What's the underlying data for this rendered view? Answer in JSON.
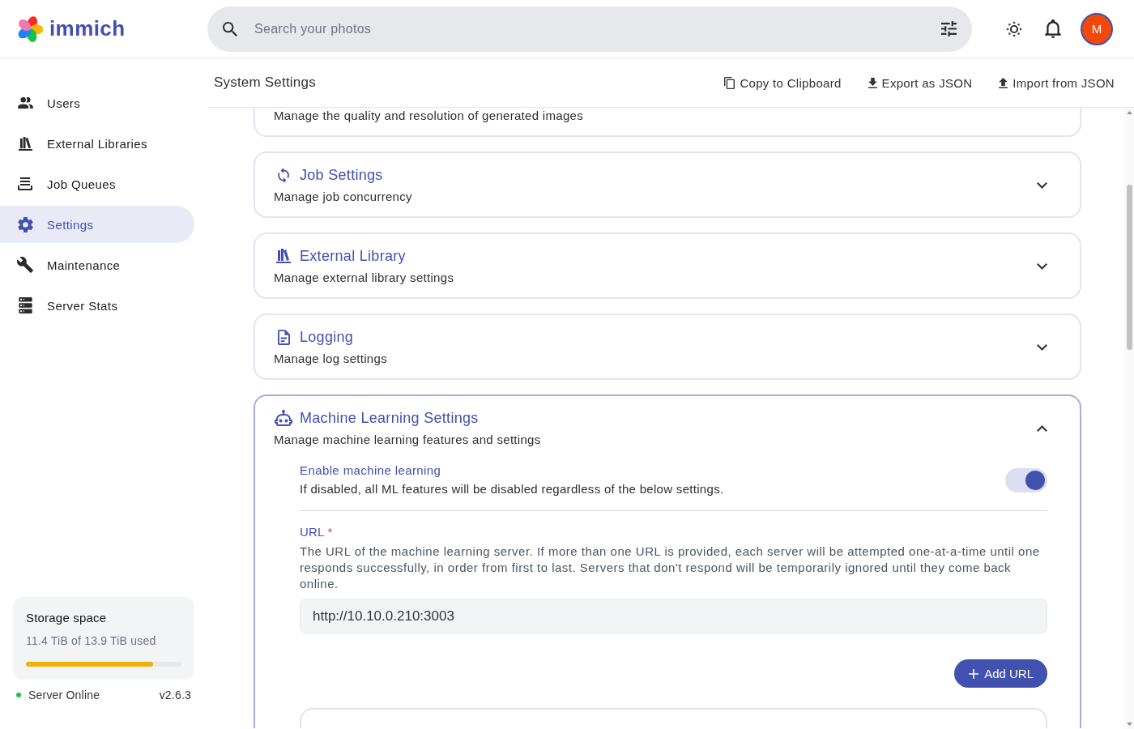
{
  "header": {
    "logo_text": "immich",
    "search": {
      "placeholder": "Search your photos"
    },
    "avatar_initial": "M"
  },
  "sidebar": {
    "items": [
      {
        "label": "Users",
        "selected": false
      },
      {
        "label": "External Libraries",
        "selected": false
      },
      {
        "label": "Job Queues",
        "selected": false
      },
      {
        "label": "Settings",
        "selected": true
      },
      {
        "label": "Maintenance",
        "selected": false
      },
      {
        "label": "Server Stats",
        "selected": false
      }
    ],
    "storage": {
      "title": "Storage space",
      "usage": "11.4 TiB of 13.9 TiB used",
      "level": 0.82
    },
    "server_status": {
      "label": "Server Online",
      "online": true,
      "version": "v2.6.3"
    }
  },
  "page": {
    "title": "System Settings",
    "actions": [
      "Copy to Clipboard",
      "Export as JSON",
      "Import from JSON"
    ]
  },
  "settings_sections": [
    {
      "kind": "clipped",
      "description": "Manage the quality and resolution of generated images"
    },
    {
      "kind": "card",
      "title": "Job Settings",
      "description": "Manage job concurrency",
      "expanded": false
    },
    {
      "kind": "card",
      "title": "External Library",
      "description": "Manage external library settings",
      "expanded": false
    },
    {
      "kind": "card",
      "title": "Logging",
      "description": "Manage log settings",
      "expanded": false
    },
    {
      "kind": "card",
      "title": "Machine Learning Settings",
      "description": "Manage machine learning features and settings",
      "expanded": true,
      "content": {
        "toggle": {
          "label": "Enable machine learning",
          "description": "If disabled, all ML features will be disabled regardless of the below settings.",
          "on": true
        },
        "url_field": {
          "label": "URL",
          "required_mark": "*",
          "description": "The URL of the machine learning server. If more than one URL is provided, each server will be attempted one-at-a-time until one responds successfully, in order from first to last. Servers that don't respond will be temporarily ignored until they come back online.",
          "value": "http://10.10.0.210:3003"
        },
        "add_button": "Add URL"
      }
    }
  ]
}
